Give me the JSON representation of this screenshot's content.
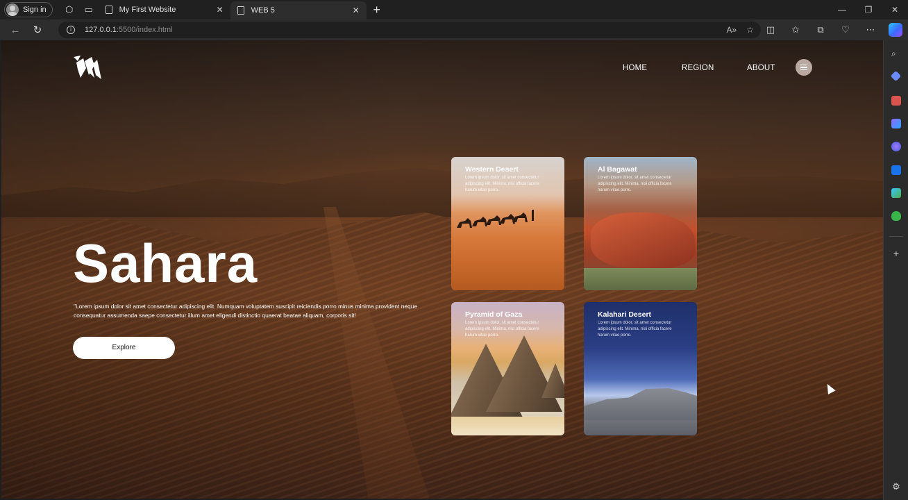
{
  "browser": {
    "signin_label": "Sign in",
    "tabs": [
      {
        "title": "My First Website",
        "active": false
      },
      {
        "title": "WEB 5",
        "active": true
      }
    ],
    "address": {
      "host": "127.0.0.1",
      "rest": ":5500/index.html"
    }
  },
  "site": {
    "nav": [
      {
        "label": "HOME"
      },
      {
        "label": "REGION"
      },
      {
        "label": "ABOUT"
      }
    ],
    "hero": {
      "title": "Sahara",
      "description": "\"Lorem ipsum dolor sit amet consectetur adipiscing elit. Numquam voluptatem suscipit reiciendis porro minus minima provident neque consequatur assumenda saepe consectetur illum amet eligendi distinctio quaerat beatae aliquam, corporis sit!",
      "button_label": "Explore"
    },
    "cards": [
      {
        "title": "Western Desert",
        "text": "Lorem ipsum dolor, sit amet consectetur adipiscing elit. Minima, nisi officia facere harum vitae porro."
      },
      {
        "title": "Al Bagawat",
        "text": "Lorem ipsum dolor, sit amet consectetur adipiscing elit. Minima, nisi officia facere harum vitae porro."
      },
      {
        "title": "Pyramid of Gaza",
        "text": "Lorem ipsum dolor, sit amet consectetur adipiscing elit. Minima, nisi officia facere harum vitae porro."
      },
      {
        "title": "Kalahari Desert",
        "text": "Lorem ipsum dolor, sit amet consectetur adipiscing elit. Minima, nisi officia facere harum vitae porro."
      }
    ]
  }
}
